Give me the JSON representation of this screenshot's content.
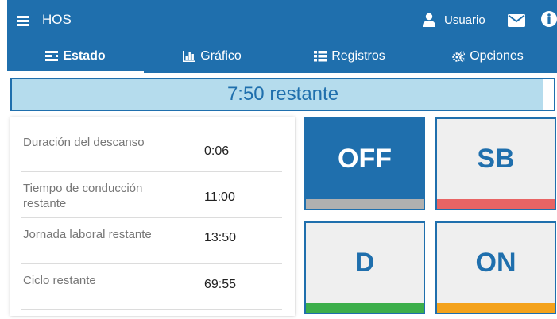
{
  "header": {
    "title": "HOS",
    "user_label": "Usuario",
    "icons": [
      "menu-icon",
      "user-icon",
      "mail-icon",
      "info-icon"
    ]
  },
  "tabs": [
    {
      "label": "Estado",
      "icon": "status-list-icon",
      "active": true
    },
    {
      "label": "Gráfico",
      "icon": "bar-chart-icon",
      "active": false
    },
    {
      "label": "Registros",
      "icon": "list-icon",
      "active": false
    },
    {
      "label": "Opciones",
      "icon": "gears-icon",
      "active": false
    }
  ],
  "remaining": {
    "text": "7:50 restante"
  },
  "info": {
    "rows": [
      {
        "label": "Duración del descanso",
        "value": "0:06"
      },
      {
        "label": "Tiempo de conducción restante",
        "value": "11:00"
      },
      {
        "label": "Jornada laboral restante",
        "value": "13:50"
      },
      {
        "label": "Ciclo restante",
        "value": "69:55"
      }
    ]
  },
  "status_buttons": [
    {
      "label": "OFF",
      "active": true,
      "stripe_color": "#b0b0b0"
    },
    {
      "label": "SB",
      "active": false,
      "stripe_color": "#e86464"
    },
    {
      "label": "D",
      "active": false,
      "stripe_color": "#3cae4a"
    },
    {
      "label": "ON",
      "active": false,
      "stripe_color": "#f4a21c"
    }
  ],
  "colors": {
    "primary": "#1f6fad",
    "remaining_fill": "#b5dced"
  }
}
